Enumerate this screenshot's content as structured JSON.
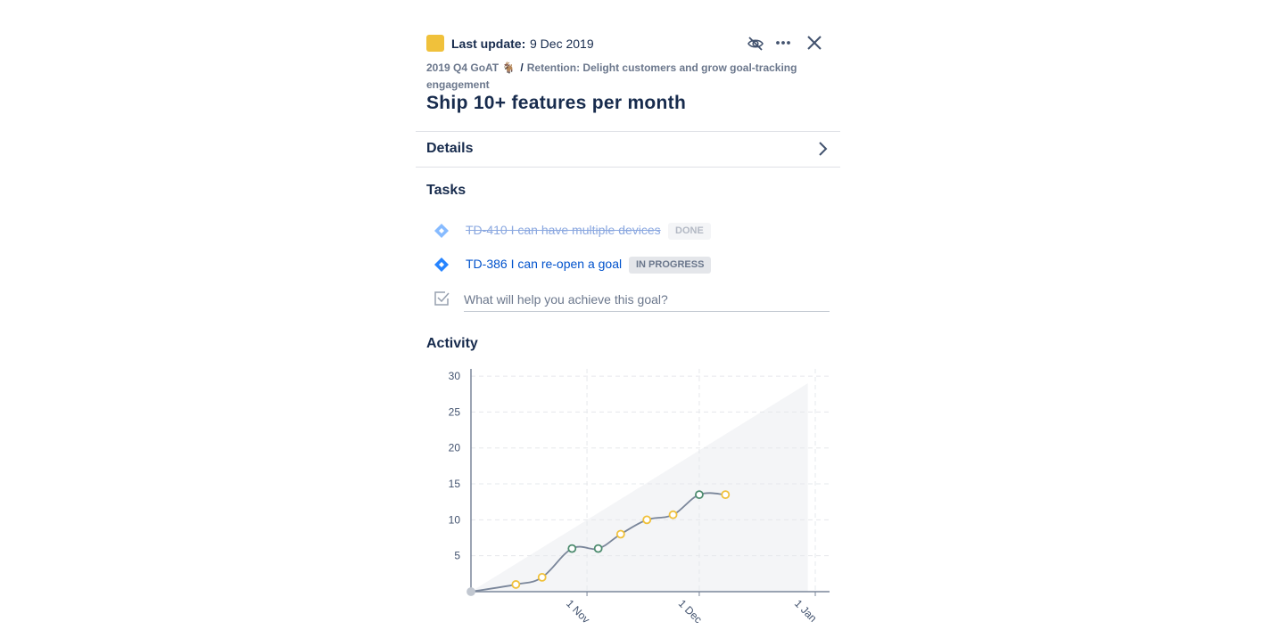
{
  "header": {
    "status_color": "#f0c13b",
    "last_update_label": "Last update:",
    "last_update_date": "9 Dec 2019",
    "icons": [
      "eye-slash-icon",
      "more-icon",
      "close-icon"
    ]
  },
  "breadcrumb": {
    "project": "2019 Q4 GoAT 🐐",
    "separator": "/",
    "parent_goal": "Retention: Delight customers and grow goal-tracking engagement"
  },
  "goal": {
    "title": "Ship 10+ features per month"
  },
  "details": {
    "label": "Details"
  },
  "tasks": {
    "title": "Tasks",
    "items": [
      {
        "key": "TD-410",
        "text": "TD-410 I can have multiple devices",
        "status": "DONE"
      },
      {
        "key": "TD-386",
        "text": "TD-386 I can re-open a goal",
        "status": "IN PROGRESS"
      }
    ],
    "new_task_placeholder": "What will help you achieve this goal?"
  },
  "activity": {
    "title": "Activity"
  },
  "chart_data": {
    "type": "line",
    "x_axis": {
      "type": "date",
      "range": [
        "2019-10-01",
        "2020-01-01"
      ],
      "tick_labels": [
        "1 Nov",
        "1 Dec",
        "1 Jan"
      ],
      "tick_dates": [
        "2019-11-01",
        "2019-12-01",
        "2020-01-01"
      ]
    },
    "y_axis": {
      "range": [
        0,
        31
      ],
      "tick_labels": [
        "5",
        "10",
        "15",
        "20",
        "25",
        "30"
      ],
      "tick_values": [
        5,
        10,
        15,
        20,
        25,
        30
      ]
    },
    "grid": true,
    "target_area": {
      "start": {
        "x": "2019-10-01",
        "y": 0
      },
      "end": {
        "x": "2019-12-30",
        "y": 29
      },
      "color": "#f4f5f7"
    },
    "series": [
      {
        "line_color": "#7a869a",
        "points": [
          {
            "x": "2019-10-01",
            "y": 0,
            "status": "start"
          },
          {
            "x": "2019-10-13",
            "y": 1,
            "status": "yellow"
          },
          {
            "x": "2019-10-20",
            "y": 2,
            "status": "yellow"
          },
          {
            "x": "2019-10-28",
            "y": 6,
            "status": "green"
          },
          {
            "x": "2019-11-04",
            "y": 6,
            "status": "green"
          },
          {
            "x": "2019-11-10",
            "y": 8,
            "status": "yellow"
          },
          {
            "x": "2019-11-17",
            "y": 10,
            "status": "yellow"
          },
          {
            "x": "2019-11-24",
            "y": 10.7,
            "status": "yellow"
          },
          {
            "x": "2019-12-01",
            "y": 13.5,
            "status": "green"
          },
          {
            "x": "2019-12-08",
            "y": 13.5,
            "status": "yellow"
          }
        ]
      }
    ],
    "status_colors": {
      "yellow": "#f0c13b",
      "green": "#4d8c6f",
      "start": "#c1c7d0"
    }
  }
}
